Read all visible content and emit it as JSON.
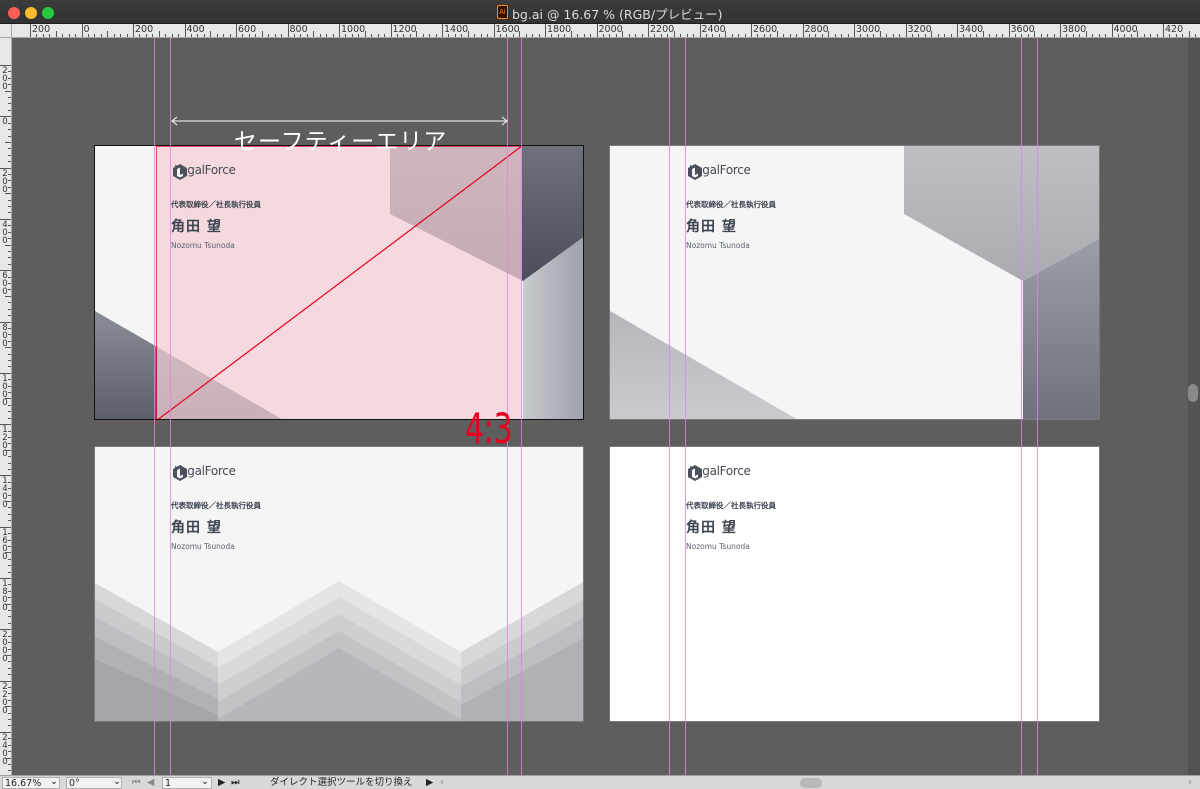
{
  "window": {
    "title": "bg.ai @ 16.67 % (RGB/プレビュー)",
    "doc_icon_letter": "Ai"
  },
  "ruler": {
    "horizontal_labels": [
      "200",
      "0",
      "200",
      "400",
      "600",
      "800",
      "1000",
      "1200",
      "1400",
      "1600",
      "1800",
      "2000",
      "2200",
      "2400",
      "2600",
      "2800",
      "3000",
      "3200",
      "3400",
      "3600",
      "3800",
      "4000",
      "420"
    ],
    "vertical_labels": [
      "200",
      "0",
      "200",
      "400",
      "600",
      "800",
      "1000",
      "1200",
      "1400",
      "1600",
      "1800",
      "2000",
      "2200",
      "2400"
    ]
  },
  "annotation": {
    "safe_area_label": "セーフティーエリア",
    "ratio_label": "4:3",
    "accent_red": "#e6001f",
    "safe_fill": "#f5cfd6",
    "guide_color": "#e67fe8"
  },
  "cards": [
    {
      "logo": "LegalForce",
      "role": "代表取締役／社長執行役員",
      "name": "角田 望",
      "romaji": "Nozomu Tsunoda"
    },
    {
      "logo": "LegalForce",
      "role": "代表取締役／社長執行役員",
      "name": "角田 望",
      "romaji": "Nozomu Tsunoda"
    },
    {
      "logo": "LegalForce",
      "role": "代表取締役／社長執行役員",
      "name": "角田 望",
      "romaji": "Nozomu Tsunoda"
    },
    {
      "logo": "LegalForce",
      "role": "代表取締役／社長執行役員",
      "name": "角田 望",
      "romaji": "Nozomu Tsunoda"
    }
  ],
  "statusbar": {
    "zoom": "16.67%",
    "rotation": "0°",
    "artboard_number": "1",
    "tool_hint": "ダイレクト選択ツールを切り換え"
  }
}
